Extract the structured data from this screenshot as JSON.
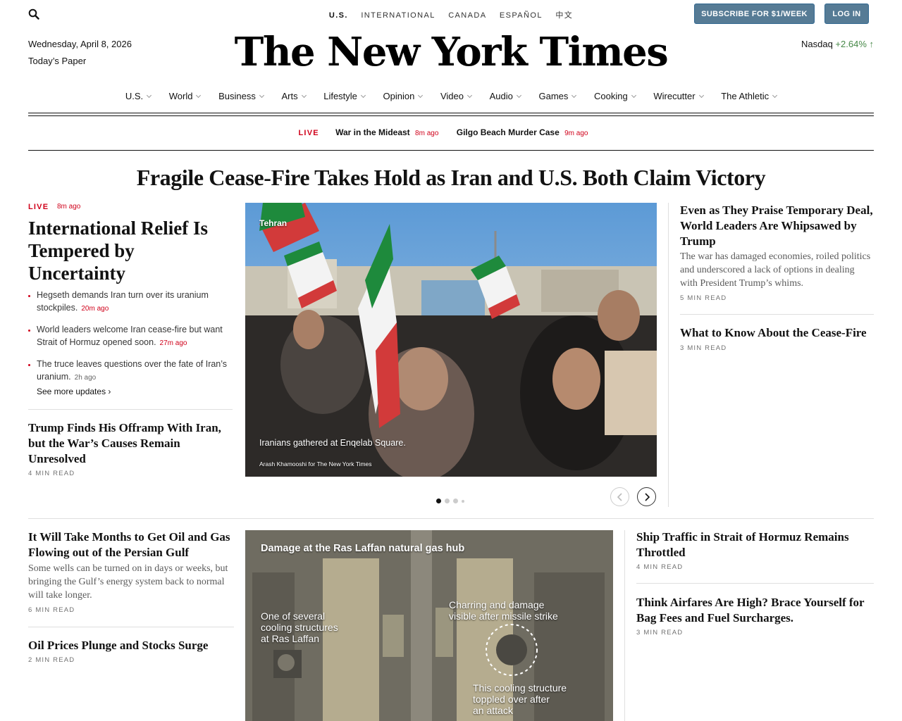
{
  "header": {
    "editions": [
      "U.S.",
      "INTERNATIONAL",
      "CANADA",
      "ESPAÑOL",
      "中文"
    ],
    "subscribe_label": "SUBSCRIBE FOR $1/WEEK",
    "login_label": "LOG IN",
    "date": "Wednesday, April 8, 2026",
    "todays_paper": "Today’s Paper",
    "masthead": "The New York Times",
    "nasdaq_label": "Nasdaq",
    "nasdaq_change": "+2.64% ↑"
  },
  "nav": {
    "items": [
      "U.S.",
      "World",
      "Business",
      "Arts",
      "Lifestyle",
      "Opinion",
      "Video",
      "Audio",
      "Games",
      "Cooking",
      "Wirecutter",
      "The Athletic"
    ]
  },
  "live_strip": {
    "live": "LIVE",
    "items": [
      {
        "title": "War in the Mideast",
        "ago": "8m ago"
      },
      {
        "title": "Gilgo Beach Murder Case",
        "ago": "9m ago"
      }
    ]
  },
  "main_headline": "Fragile Cease-Fire Takes Hold as Iran and U.S. Both Claim Victory",
  "left": {
    "live": "LIVE",
    "live_ago": "8m ago",
    "lead": "International Relief Is Tempered by Uncertainty",
    "bullets": [
      {
        "text": "Hegseth demands Iran turn over its uranium stockpiles.",
        "ago": "20m ago"
      },
      {
        "text": "World leaders welcome Iran cease-fire but want Strait of Hormuz opened soon.",
        "ago": "27m ago"
      },
      {
        "text": "The truce leaves questions over the fate of Iran’s uranium.",
        "ago": "2h ago"
      }
    ],
    "see_more": "See more updates ›",
    "story2": {
      "headline": "Trump Finds His Offramp With Iran, but the War’s Causes Remain Unresolved",
      "read": "4 MIN READ"
    }
  },
  "lead_image": {
    "location": "Tehran",
    "caption": "Iranians gathered at Enqelab Square.",
    "credit": "Arash Khamooshi for The New York Times"
  },
  "right": {
    "story1": {
      "headline": "Even as They Praise Temporary Deal, World Leaders Are Whipsawed by Trump",
      "summary": "The war has damaged economies, roiled politics and underscored a lack of options in dealing with President Trump’s whims.",
      "read": "5 MIN READ"
    },
    "story2": {
      "headline": "What to Know About the Cease-Fire",
      "read": "3 MIN READ"
    }
  },
  "section2": {
    "left": {
      "story1": {
        "headline": "It Will Take Months to Get Oil and Gas Flowing out of the Persian Gulf",
        "summary": "Some wells can be turned on in days or weeks, but bringing the Gulf’s energy system back to normal will take longer.",
        "read": "6 MIN READ"
      },
      "story2": {
        "headline": "Oil Prices Plunge and Stocks Surge",
        "read": "2 MIN READ"
      }
    },
    "diagram": {
      "title": "Damage at the Ras Laffan natural gas hub",
      "label1": [
        "One of several",
        "cooling structures",
        "at Ras Laffan"
      ],
      "label2": [
        "Charring and damage",
        "visible after missile strike"
      ],
      "label3": [
        "This cooling structure",
        "toppled over after",
        "an attack"
      ]
    },
    "right": {
      "story1": {
        "headline": "Ship Traffic in Strait of Hormuz Remains Throttled",
        "read": "4 MIN READ"
      },
      "story2": {
        "headline": "Think Airfares Are High? Brace Yourself for Bag Fees and Fuel Surcharges.",
        "read": "3 MIN READ"
      }
    }
  }
}
